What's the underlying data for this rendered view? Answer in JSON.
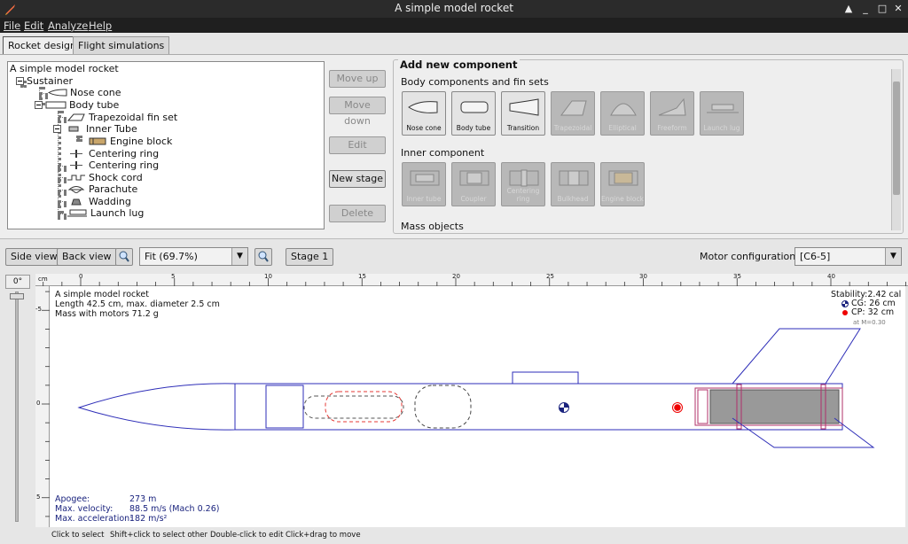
{
  "window": {
    "title": "A simple model rocket"
  },
  "menu": [
    "File",
    "Edit",
    "Analyze",
    "Help"
  ],
  "tabs": [
    "Rocket design",
    "Flight simulations"
  ],
  "tree": {
    "root": "A simple model rocket",
    "stage": "Sustainer",
    "nose": "Nose cone",
    "body": "Body tube",
    "fins": "Trapezoidal fin set",
    "inner": "Inner Tube",
    "engine": "Engine block",
    "ring1": "Centering ring",
    "ring2": "Centering ring",
    "shock": "Shock cord",
    "chute": "Parachute",
    "wadding": "Wadding",
    "lug": "Launch lug"
  },
  "side_buttons": {
    "move_up": "Move up",
    "move_down": "Move down",
    "edit": "Edit",
    "new_stage": "New stage",
    "delete": "Delete"
  },
  "add_panel": {
    "title": "Add new component",
    "body_section": "Body components and fin sets",
    "inner_section": "Inner component",
    "mass_section": "Mass objects",
    "body_buttons": [
      "Nose cone",
      "Body tube",
      "Transition",
      "Trapezoidal",
      "Elliptical",
      "Freeform",
      "Launch lug"
    ],
    "inner_buttons": [
      "Inner tube",
      "Coupler",
      "Centering ring",
      "Bulkhead",
      "Engine block"
    ]
  },
  "toolbar": {
    "side_view": "Side view",
    "back_view": "Back view",
    "zoom": "Fit (69.7%)",
    "stage": "Stage 1",
    "motor_label": "Motor configuration:",
    "motor_value": "[C6-5]"
  },
  "figure": {
    "angle": "0°",
    "unit": "cm",
    "ruler_h": [
      "0",
      "5",
      "10",
      "15",
      "20",
      "25",
      "30",
      "35",
      "40"
    ],
    "ruler_v": [
      "-5",
      "0",
      "5"
    ],
    "info_name": "A simple model rocket",
    "info_length": "Length 42.5 cm, max. diameter 2.5 cm",
    "info_mass": "Mass with motors 71.2 g",
    "stability": "Stability:2.42 cal",
    "cg": "CG:  26 cm",
    "cp": "CP:  32 cm",
    "mach": "at M=0.30",
    "apogee_label": "Apogee:",
    "apogee_value": "273 m",
    "vel_label": "Max. velocity:",
    "vel_value": "88.5 m/s  (Mach 0.26)",
    "acc_label": "Max. acceleration:",
    "acc_value": "182 m/s²"
  },
  "status": [
    "Click to select",
    "Shift+click to select other",
    "Double-click to edit",
    "Click+drag to move"
  ],
  "colors": {
    "outline": "#2e2eb8",
    "inner": "#b0306a",
    "motor": "#999999",
    "cp": "#ee0000"
  }
}
